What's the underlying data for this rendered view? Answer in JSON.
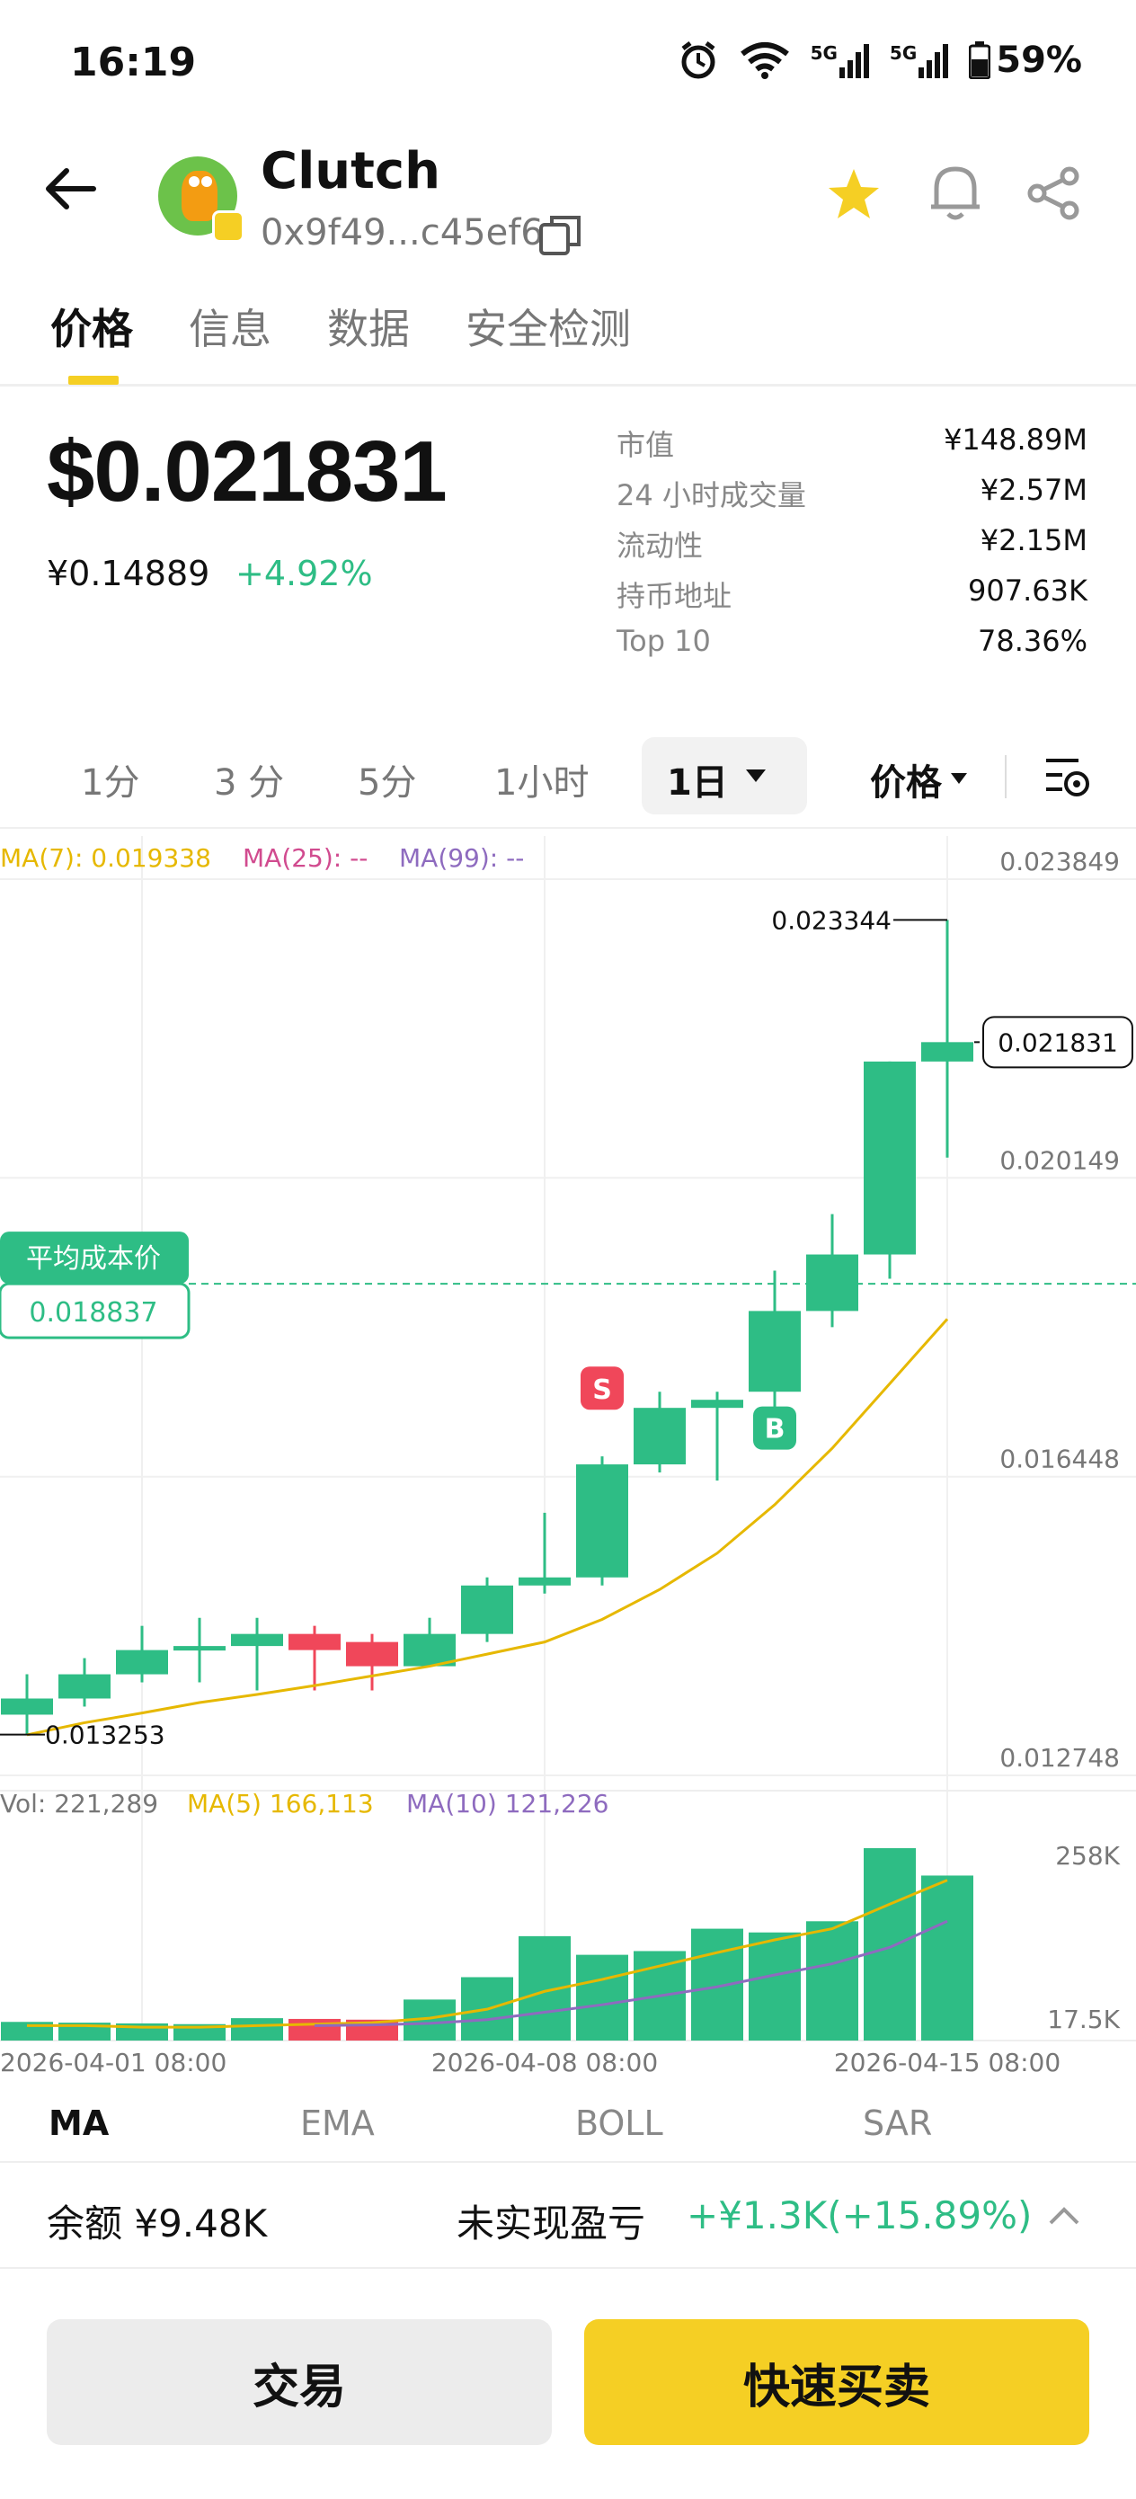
{
  "status_bar": {
    "time": "16:19",
    "net1": "5G",
    "net2": "5G",
    "battery": "59%",
    "icons": [
      "alarm-icon",
      "wifi-icon",
      "signal-5g-icon",
      "signal-5g-icon",
      "battery-icon"
    ]
  },
  "header": {
    "token_name": "Clutch",
    "address": "0x9f49...c45ef6",
    "favorite": true,
    "accent_color": "#f5cf24"
  },
  "tabs": [
    {
      "label": "价格",
      "active": true
    },
    {
      "label": "信息",
      "active": false
    },
    {
      "label": "数据",
      "active": false
    },
    {
      "label": "安全检测",
      "active": false
    }
  ],
  "price": {
    "usd": "$0.021831",
    "cny": "¥0.14889",
    "change": "+4.92%",
    "change_color": "#2ebd85"
  },
  "stats": [
    {
      "label": "市值",
      "value": "¥148.89M"
    },
    {
      "label": "24 小时成交量",
      "value": "¥2.57M"
    },
    {
      "label": "流动性",
      "value": "¥2.15M"
    },
    {
      "label": "持币地址",
      "value": "907.63K"
    },
    {
      "label": "Top 10",
      "value": "78.36%"
    }
  ],
  "intervals": {
    "items": [
      "1分",
      "3 分",
      "5分",
      "1小时"
    ],
    "selected": "1日",
    "type_select": "价格"
  },
  "chart_legend": {
    "ma7": "MA(7): 0.019338",
    "ma25": "MA(25): --",
    "ma99": "MA(99): --",
    "vol": "Vol: 221,289",
    "vol_ma5": "MA(5) 166,113",
    "vol_ma10": "MA(10) 121,226"
  },
  "chart_labels": {
    "y_ticks": [
      "0.023849",
      "0.020149",
      "0.016448",
      "0.012748"
    ],
    "high_label": "0.023344",
    "low_label": "0.013253",
    "current_price": "0.021831",
    "avg_cost_title": "平均成本价",
    "avg_cost_value": "0.018837",
    "sell_marker": "S",
    "buy_marker": "B",
    "vol_ticks": [
      "258K",
      "17.5K"
    ],
    "x_ticks": [
      "2026-04-01 08:00",
      "2026-04-08 08:00",
      "2026-04-15 08:00"
    ]
  },
  "chart_data": {
    "type": "candlestick",
    "up_color": "#2ebd85",
    "down_color": "#f0475a",
    "ylim": [
      0.012748,
      0.023849
    ],
    "candles": [
      {
        "o": 0.0135,
        "c": 0.0137,
        "h": 0.014,
        "l": 0.01325,
        "v": 25000
      },
      {
        "o": 0.0137,
        "c": 0.014,
        "h": 0.0142,
        "l": 0.0136,
        "v": 24000
      },
      {
        "o": 0.014,
        "c": 0.0143,
        "h": 0.0146,
        "l": 0.0139,
        "v": 23000
      },
      {
        "o": 0.0143,
        "c": 0.01435,
        "h": 0.0147,
        "l": 0.0139,
        "v": 22000
      },
      {
        "o": 0.01435,
        "c": 0.0145,
        "h": 0.0147,
        "l": 0.0138,
        "v": 30000
      },
      {
        "o": 0.0145,
        "c": 0.0143,
        "h": 0.0146,
        "l": 0.0138,
        "v": 29000
      },
      {
        "o": 0.0144,
        "c": 0.0141,
        "h": 0.0145,
        "l": 0.0138,
        "v": 28000
      },
      {
        "o": 0.0141,
        "c": 0.0145,
        "h": 0.0147,
        "l": 0.0141,
        "v": 55000
      },
      {
        "o": 0.0145,
        "c": 0.0151,
        "h": 0.0152,
        "l": 0.0144,
        "v": 85000
      },
      {
        "o": 0.0151,
        "c": 0.0152,
        "h": 0.016,
        "l": 0.015,
        "v": 140000
      },
      {
        "o": 0.0152,
        "c": 0.0166,
        "h": 0.0167,
        "l": 0.0151,
        "v": 115000
      },
      {
        "o": 0.0166,
        "c": 0.0173,
        "h": 0.0175,
        "l": 0.0165,
        "v": 120000
      },
      {
        "o": 0.0173,
        "c": 0.0174,
        "h": 0.0175,
        "l": 0.0164,
        "v": 150000
      },
      {
        "o": 0.0175,
        "c": 0.0185,
        "h": 0.019,
        "l": 0.0172,
        "v": 145000
      },
      {
        "o": 0.0185,
        "c": 0.0192,
        "h": 0.0197,
        "l": 0.0183,
        "v": 160000
      },
      {
        "o": 0.0192,
        "c": 0.02159,
        "h": 0.02159,
        "l": 0.0189,
        "v": 258000
      },
      {
        "o": 0.02159,
        "c": 0.02183,
        "h": 0.023344,
        "l": 0.0204,
        "v": 221289
      }
    ],
    "ma7": [
      0.01325,
      0.0134,
      0.01352,
      0.01365,
      0.01375,
      0.01386,
      0.01398,
      0.0141,
      0.01425,
      0.0144,
      0.01468,
      0.01505,
      0.0155,
      0.0161,
      0.0168,
      0.0176,
      0.0184
    ],
    "vol_ma5": [
      20000,
      20000,
      18000,
      18000,
      20000,
      22000,
      24000,
      30000,
      42000,
      66000,
      82000,
      100000,
      118000,
      135000,
      150000,
      183000,
      215000
    ],
    "vol_ma10": [
      null,
      null,
      null,
      null,
      null,
      20000,
      21000,
      23000,
      28000,
      38000,
      48000,
      60000,
      72000,
      88000,
      103000,
      125000,
      160000
    ]
  },
  "ma_tabs": [
    {
      "label": "MA",
      "active": true
    },
    {
      "label": "EMA",
      "active": false
    },
    {
      "label": "BOLL",
      "active": false
    },
    {
      "label": "SAR",
      "active": false
    }
  ],
  "balance": {
    "label": "余额 ¥9.48K",
    "pnl_label": "未实现盈亏",
    "pnl_value": "+¥1.3K(+15.89%)"
  },
  "buttons": {
    "trade": "交易",
    "quick": "快速买卖"
  }
}
